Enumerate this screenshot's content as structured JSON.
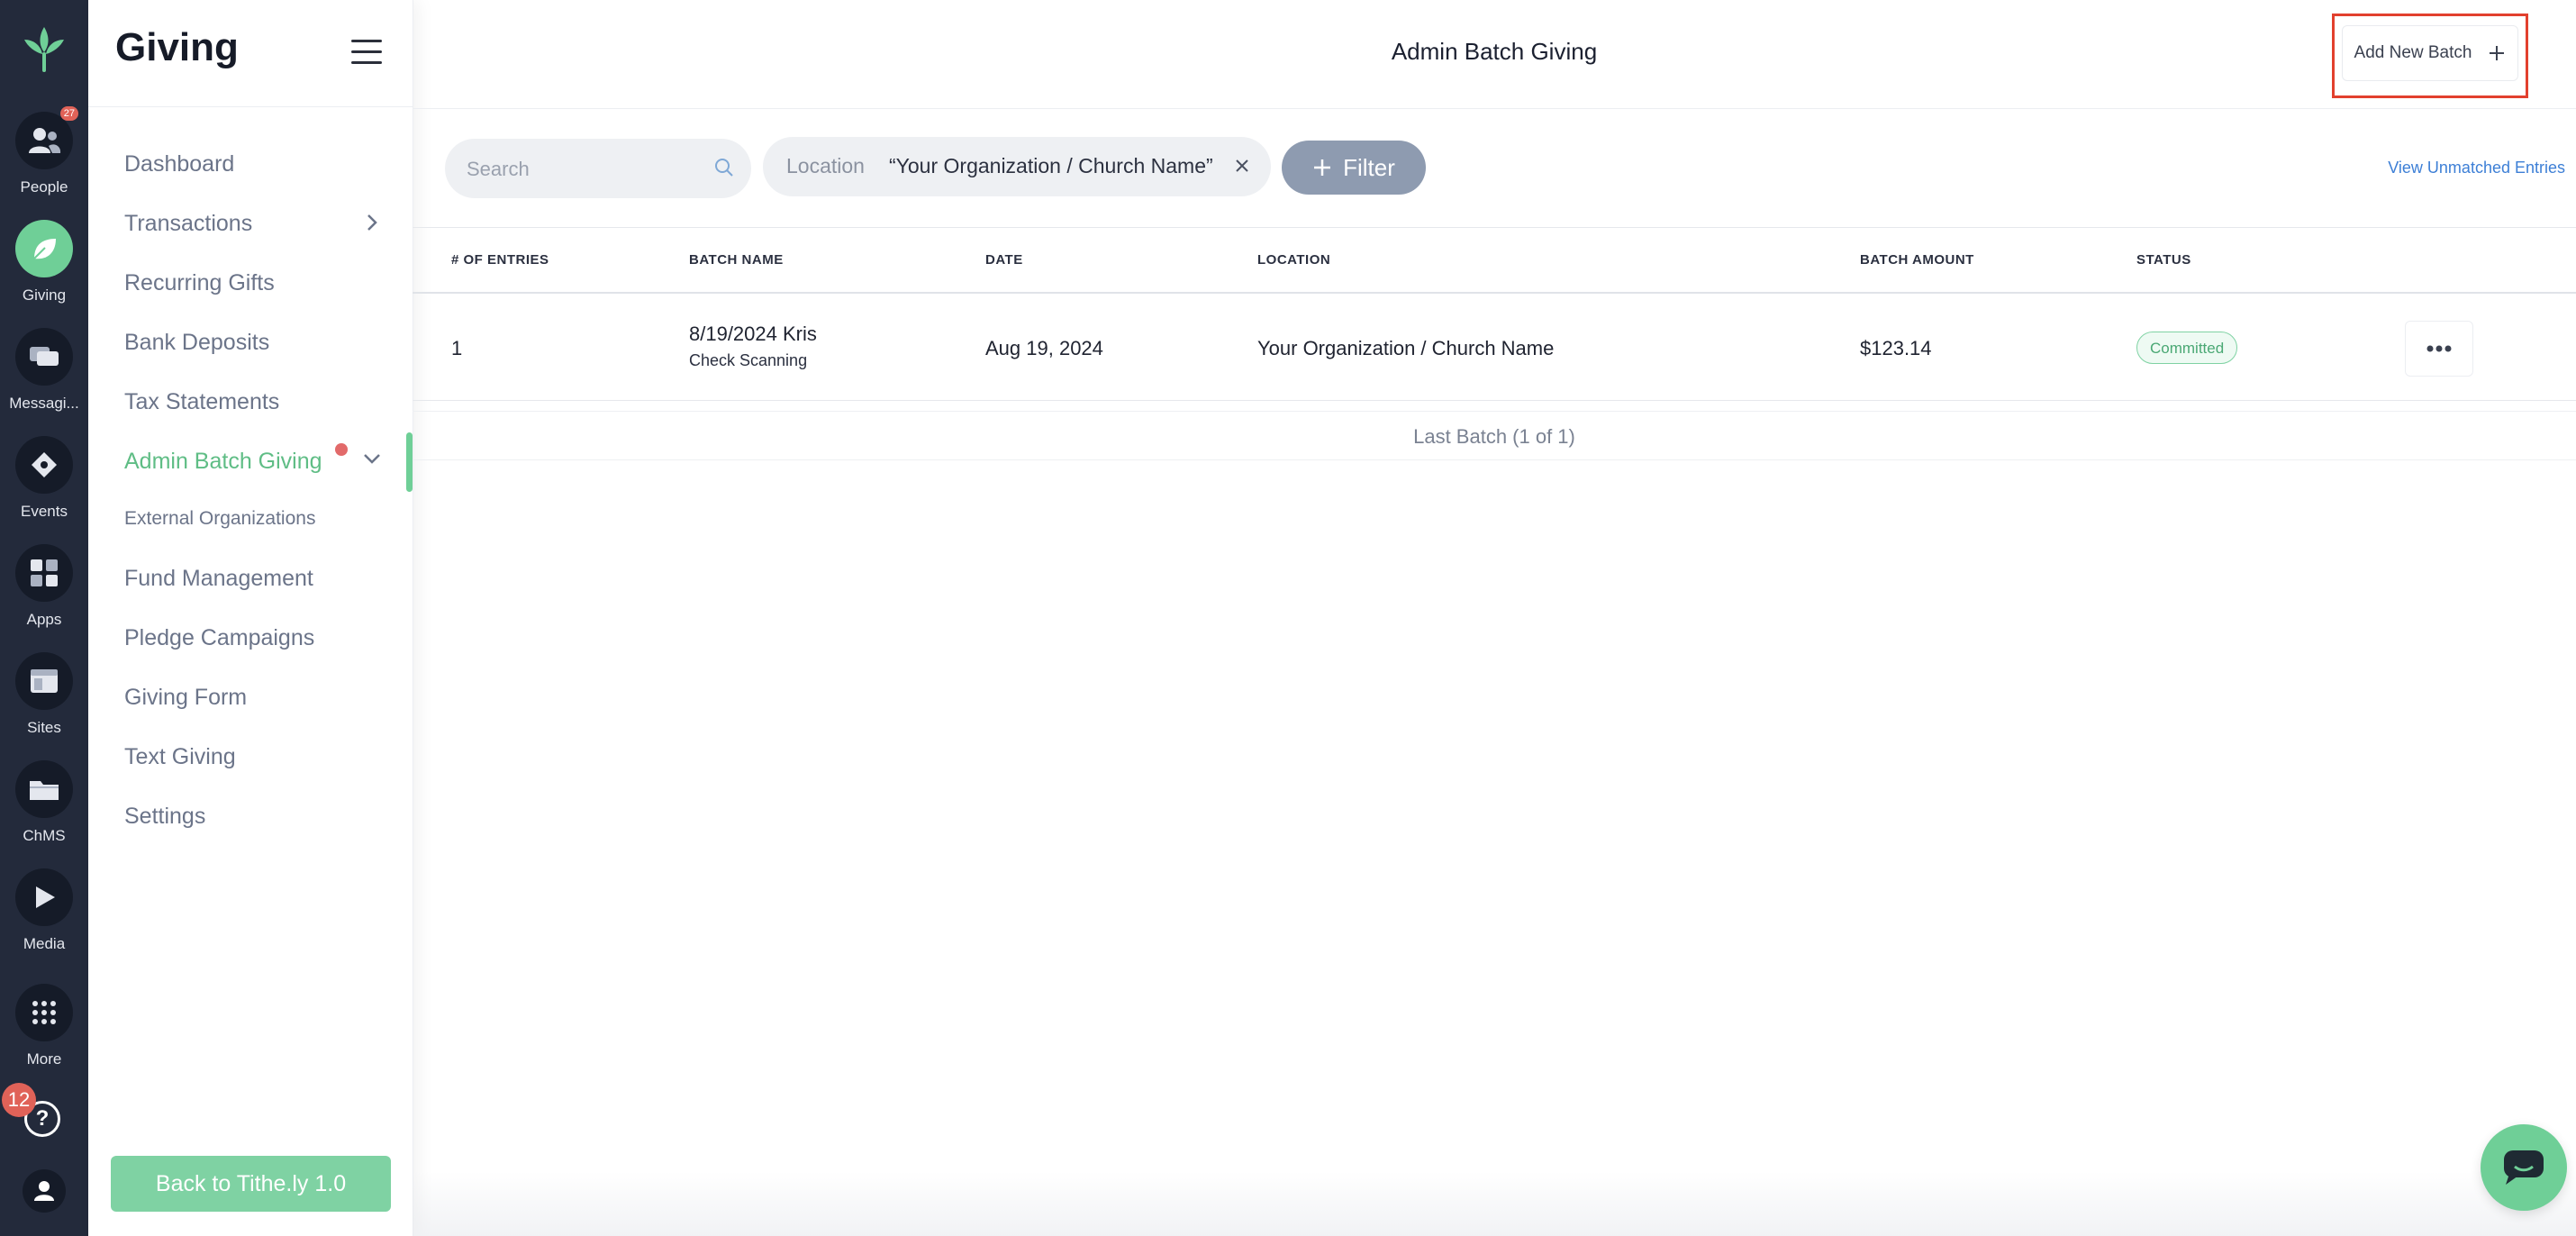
{
  "rail": {
    "items": [
      {
        "key": "people",
        "label": "People",
        "icon": "people-icon",
        "badge": "27"
      },
      {
        "key": "giving",
        "label": "Giving",
        "icon": "leaf-icon",
        "active": true
      },
      {
        "key": "messaging",
        "label": "Messagi...",
        "icon": "chat-bubble-icon"
      },
      {
        "key": "events",
        "label": "Events",
        "icon": "ticket-icon"
      },
      {
        "key": "apps",
        "label": "Apps",
        "icon": "grid-icon"
      },
      {
        "key": "sites",
        "label": "Sites",
        "icon": "browser-icon"
      },
      {
        "key": "chms",
        "label": "ChMS",
        "icon": "folder-icon"
      },
      {
        "key": "media",
        "label": "Media",
        "icon": "play-icon"
      },
      {
        "key": "more",
        "label": "More",
        "icon": "dots-grid-icon"
      }
    ],
    "help_badge": "12",
    "help_symbol": "?"
  },
  "sidebar": {
    "title": "Giving",
    "items": [
      {
        "label": "Dashboard"
      },
      {
        "label": "Transactions"
      },
      {
        "label": "Recurring Gifts"
      },
      {
        "label": "Bank Deposits"
      },
      {
        "label": "Tax Statements"
      },
      {
        "label": "Admin Batch Giving"
      },
      {
        "label": "External Organizations"
      },
      {
        "label": "Fund Management"
      },
      {
        "label": "Pledge Campaigns"
      },
      {
        "label": "Giving Form"
      },
      {
        "label": "Text Giving"
      },
      {
        "label": "Settings"
      }
    ],
    "back_label": "Back to Tithe.ly 1.0"
  },
  "header": {
    "title": "Admin Batch Giving",
    "add_batch_label": "Add New Batch"
  },
  "filters": {
    "search_placeholder": "Search",
    "location_label": "Location",
    "location_value": "“Your Organization / Church Name”",
    "filter_label": "Filter",
    "unmatched_link": "View Unmatched Entries"
  },
  "table": {
    "columns": [
      "# OF ENTRIES",
      "BATCH NAME",
      "DATE",
      "LOCATION",
      "BATCH AMOUNT",
      "STATUS"
    ],
    "rows": [
      {
        "entries": "1",
        "batch_name": "8/19/2024 Kris",
        "batch_type": "Check Scanning",
        "date": "Aug 19, 2024",
        "location": "Your Organization / Church Name",
        "amount": "$123.14",
        "status": "Committed"
      }
    ],
    "footer": "Last Batch (1 of 1)"
  },
  "colors": {
    "rail_bg": "#232a3b",
    "accent_green": "#6fcf97",
    "highlight_red": "#e2402e",
    "link_blue": "#3d7fd6"
  }
}
